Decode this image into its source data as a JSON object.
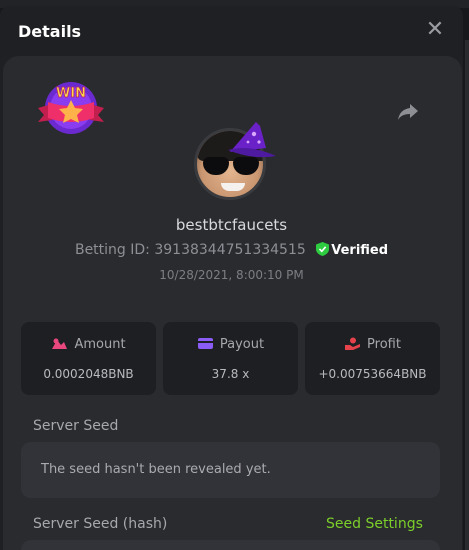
{
  "header": {
    "title": "Details"
  },
  "profile": {
    "badge_text": "WIN",
    "username": "bestbtcfaucets",
    "betting_id_label": "Betting ID:",
    "betting_id": "39138344751334515",
    "verified_label": "Verified",
    "date": "10/28/2021, 8:00:10 PM"
  },
  "stats": [
    {
      "label": "Amount",
      "value": "0.0002048BNB",
      "icon": "amount-icon",
      "icon_color": "#e8487e"
    },
    {
      "label": "Payout",
      "value": "37.8 x",
      "icon": "payout-card-icon",
      "icon_color": "#8b5cf6"
    },
    {
      "label": "Profit",
      "value": "+0.00753664BNB",
      "icon": "profit-hand-icon",
      "icon_color": "#e6424b"
    }
  ],
  "server_seed": {
    "label": "Server Seed",
    "message": "The seed hasn't been revealed yet."
  },
  "server_seed_hash": {
    "label": "Server Seed (hash)",
    "settings_link": "Seed Settings"
  },
  "colors": {
    "accent_green": "#7ccf2a",
    "verified_green": "#2ecc40",
    "panel": "#2a2b2f",
    "background": "#1f2023"
  }
}
